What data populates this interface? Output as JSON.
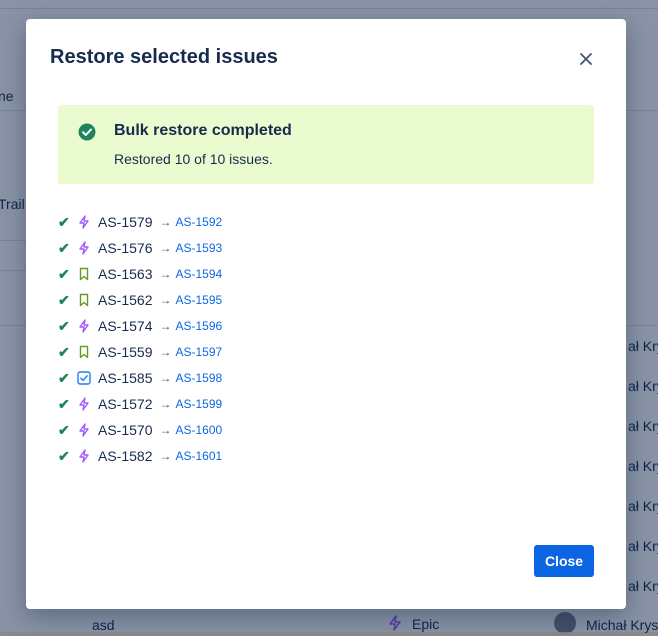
{
  "background": {
    "column_header_name": "ne",
    "trail_text": "Trail",
    "assignee_truncated": "ał Krys",
    "bottom_row": {
      "summary": "asd",
      "type": "Epic",
      "assignee": "Michał Krys"
    }
  },
  "modal": {
    "title": "Restore selected issues",
    "banner": {
      "title": "Bulk restore completed",
      "message": "Restored 10 of 10 issues."
    },
    "arrow": "→",
    "check": "✔",
    "issues": [
      {
        "key": "AS-1579",
        "new_key": "AS-1592",
        "type": "lightning-icon"
      },
      {
        "key": "AS-1576",
        "new_key": "AS-1593",
        "type": "lightning-icon"
      },
      {
        "key": "AS-1563",
        "new_key": "AS-1594",
        "type": "bookmark-icon"
      },
      {
        "key": "AS-1562",
        "new_key": "AS-1595",
        "type": "bookmark-icon"
      },
      {
        "key": "AS-1574",
        "new_key": "AS-1596",
        "type": "lightning-icon"
      },
      {
        "key": "AS-1559",
        "new_key": "AS-1597",
        "type": "bookmark-icon"
      },
      {
        "key": "AS-1585",
        "new_key": "AS-1598",
        "type": "task-checkbox-icon"
      },
      {
        "key": "AS-1572",
        "new_key": "AS-1599",
        "type": "lightning-icon"
      },
      {
        "key": "AS-1570",
        "new_key": "AS-1600",
        "type": "lightning-icon"
      },
      {
        "key": "AS-1582",
        "new_key": "AS-1601",
        "type": "lightning-icon"
      }
    ],
    "close_label": "Close"
  },
  "colors": {
    "success": "#1f845a",
    "banner_bg": "#eafccf",
    "link": "#0c66e4",
    "primary_button": "#0c66e4",
    "lightning": "#a259ff",
    "bookmark": "#6a9a23",
    "task": "#1d7afc"
  }
}
